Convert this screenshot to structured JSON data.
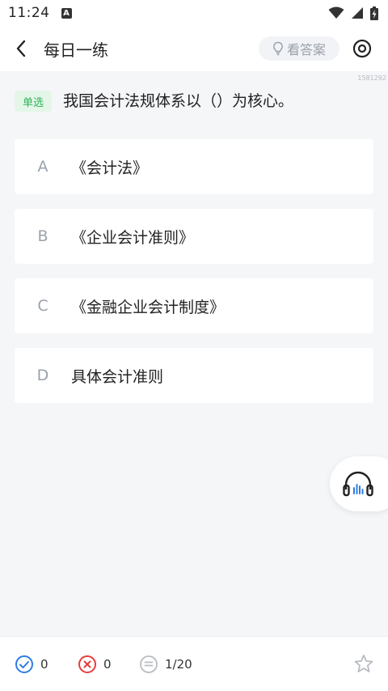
{
  "status_bar": {
    "time": "11:24",
    "a_badge": "A"
  },
  "header": {
    "title": "每日一练",
    "answer_label": "看答案"
  },
  "question": {
    "id": "1581292",
    "type": "单选",
    "text": "我国会计法规体系以（）为核心。"
  },
  "options": [
    {
      "letter": "A",
      "text": "《会计法》"
    },
    {
      "letter": "B",
      "text": "《企业会计准则》"
    },
    {
      "letter": "C",
      "text": "《金融企业会计制度》"
    },
    {
      "letter": "D",
      "text": "具体会计准则"
    }
  ],
  "footer": {
    "correct": "0",
    "wrong": "0",
    "progress": "1/20"
  },
  "colors": {
    "correct": "#2f7de1",
    "wrong": "#e63c3c",
    "badge_green": "#2fb35a",
    "audio_blue": "#2f7de1"
  }
}
